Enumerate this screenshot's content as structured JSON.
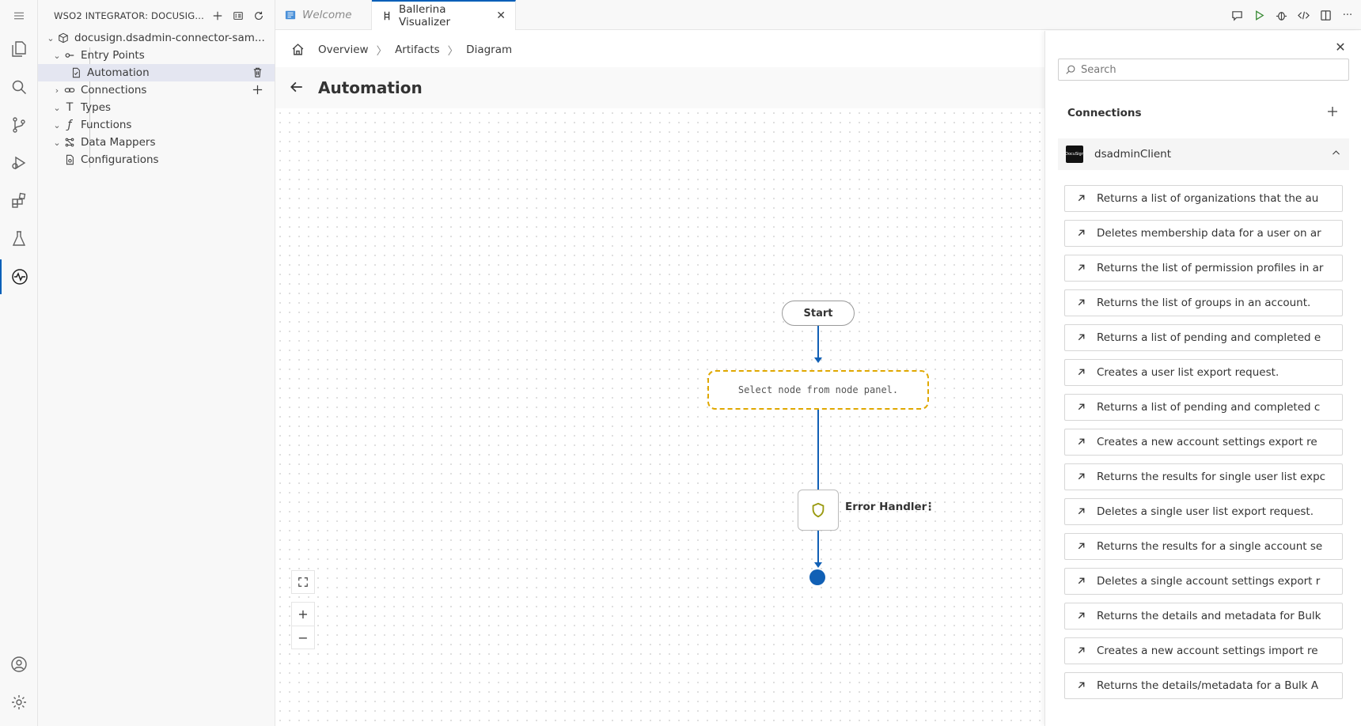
{
  "explorer": {
    "title": "WSO2 INTEGRATOR: DOCUSIG...",
    "project": "docusign.dsadmin-connector-sam...",
    "items": [
      {
        "label": "Entry Points"
      },
      {
        "label": "Automation"
      },
      {
        "label": "Connections"
      },
      {
        "label": "Types"
      },
      {
        "label": "Functions"
      },
      {
        "label": "Data Mappers"
      },
      {
        "label": "Configurations"
      }
    ]
  },
  "tabs": [
    {
      "label": "Welcome"
    },
    {
      "label": "Ballerina Visualizer"
    }
  ],
  "breadcrumb": {
    "items": [
      "Overview",
      "Artifacts",
      "Diagram"
    ]
  },
  "page": {
    "title": "Automation"
  },
  "diagram": {
    "start_label": "Start",
    "placeholder_text": "Select node from node panel.",
    "error_handler_label": "Error Handler"
  },
  "zoom": {
    "plus": "+",
    "minus": "−"
  },
  "panel": {
    "search_placeholder": "Search",
    "section_title": "Connections",
    "connection_name": "dsadminClient",
    "operations": [
      "Returns a list of organizations that the au",
      "Deletes membership data for a user on ar",
      "Returns the list of permission profiles in ar",
      "Returns the list of groups in an account.",
      "Returns a list of pending and completed e",
      "Creates a user list export request.",
      "Returns a list of pending and completed c",
      "Creates a new account settings export re",
      "Returns the results for single user list expc",
      "Deletes a single user list export request.",
      "Returns the results for a single account se",
      "Deletes a single account settings export r",
      "Returns the details and metadata for Bulk",
      "Creates a new account settings import re",
      "Returns the details/metadata for a Bulk A"
    ]
  },
  "colors": {
    "accent": "#005fb8",
    "flow_line": "#1160b5",
    "placeholder_border": "#e0a800"
  }
}
